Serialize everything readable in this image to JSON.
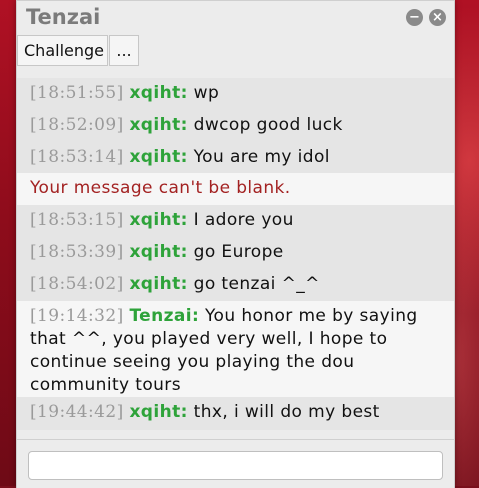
{
  "window": {
    "title": "Tenzai",
    "minimize_glyph": "−",
    "close_glyph": "×"
  },
  "tabs": [
    {
      "label": "Challenge"
    },
    {
      "label": "..."
    }
  ],
  "messages": [
    {
      "time": "[18:51:55]",
      "user": "xqiht:",
      "text": "wp"
    },
    {
      "time": "[18:52:09]",
      "user": "xqiht:",
      "text": "dwcop good luck"
    },
    {
      "time": "[18:53:14]",
      "user": "xqiht:",
      "text": "You are my idol"
    },
    {
      "error": "Your message can't be blank."
    },
    {
      "time": "[18:53:15]",
      "user": "xqiht:",
      "text": "I adore you"
    },
    {
      "time": "[18:53:39]",
      "user": "xqiht:",
      "text": "go Europe"
    },
    {
      "time": "[18:54:02]",
      "user": "xqiht:",
      "text": "go tenzai ^_^"
    },
    {
      "time": "[19:14:32]",
      "user": "Tenzai:",
      "text": "You honor me by saying that ^^, you played very well, I hope to continue seeing you playing the dou community tours"
    },
    {
      "time": "[19:44:42]",
      "user": "xqiht:",
      "text": "thx,  i will do my best"
    }
  ],
  "input": {
    "value": "",
    "placeholder": ""
  },
  "colors": {
    "username": "#2ea33a",
    "error": "#a32222",
    "timestamp": "#9a9a9a"
  }
}
